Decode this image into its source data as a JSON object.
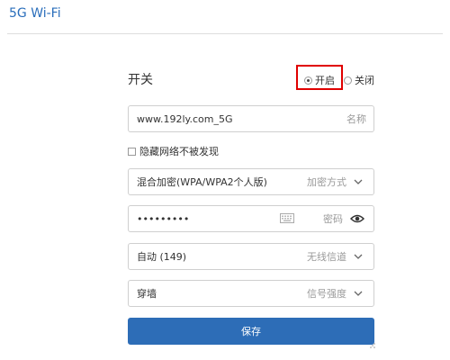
{
  "page": {
    "title": "5G Wi-Fi"
  },
  "switch": {
    "label": "开关",
    "on_label": "开启",
    "off_label": "关闭",
    "selected": "on"
  },
  "ssid": {
    "value": "www.192ly.com_5G",
    "hint": "名称"
  },
  "hide_network": {
    "label": "隐藏网络不被发现",
    "checked": false
  },
  "encryption": {
    "value": "混合加密(WPA/WPA2个人版)",
    "hint": "加密方式"
  },
  "password": {
    "value": "•••••••••",
    "hint": "密码"
  },
  "channel": {
    "value": "自动 (149)",
    "hint": "无线信道"
  },
  "signal": {
    "value": "穿墙",
    "hint": "信号强度"
  },
  "save": {
    "label": "保存"
  },
  "colors": {
    "title": "#2a6ebb",
    "primary_button": "#2d6db7",
    "highlight_border": "#e00000",
    "field_border": "#cfcfcf",
    "hint_text": "#9a9a9a"
  },
  "icons": {
    "dropdown": "chevron-down-icon",
    "show_password": "eye-icon",
    "keyboard": "keyboard-icon"
  }
}
